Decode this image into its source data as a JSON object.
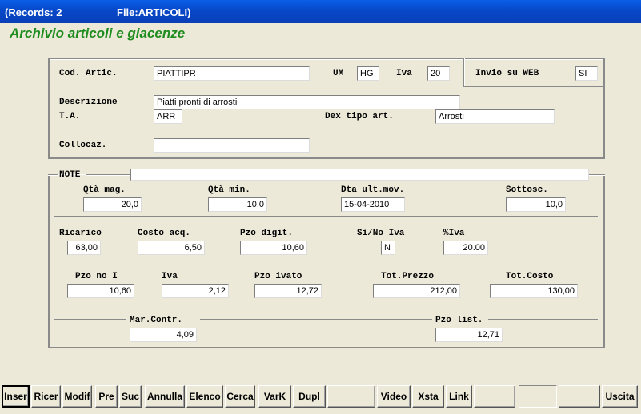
{
  "titlebar": {
    "records": "(Records: 2",
    "file": "File:ARTICOLI)"
  },
  "heading": "Archivio articoli e giacenze",
  "top_section": {
    "cod_artic": {
      "label": "Cod. Artic.",
      "value": "PIATTIPR"
    },
    "um": {
      "label": "UM",
      "value": "HG"
    },
    "iva": {
      "label": "Iva",
      "value": "20"
    },
    "invio_web": {
      "label": "Invio su WEB",
      "value": "SI"
    },
    "descrizione": {
      "label": "Descrizione",
      "value": "Piatti pronti di arrosti"
    },
    "ta": {
      "label": "T.A.",
      "value": "ARR"
    },
    "dex_tipo": {
      "label": "Dex tipo art.",
      "value": "Arrosti"
    },
    "collocaz": {
      "label": "Collocaz.",
      "value": ""
    }
  },
  "bottom_section": {
    "note": {
      "label": "NOTE",
      "value": ""
    },
    "qta_mag": {
      "label": "Qtà mag.",
      "value": "20,0"
    },
    "qta_min": {
      "label": "Qtà min.",
      "value": "10,0"
    },
    "dta_ult_mov": {
      "label": "Dta ult.mov.",
      "value": "15-04-2010"
    },
    "sottosc": {
      "label": "Sottosc.",
      "value": "10,0"
    },
    "ricarico": {
      "label": "Ricarico",
      "value": "63,00"
    },
    "costo_acq": {
      "label": "Costo acq.",
      "value": "6,50"
    },
    "pzo_digit": {
      "label": "Pzo digit.",
      "value": "10,60"
    },
    "si_no_iva": {
      "label": "Sì/No Iva",
      "value": "N"
    },
    "perc_iva": {
      "label": "%Iva",
      "value": "20.00"
    },
    "pzo_no_i": {
      "label": "Pzo no I",
      "value": "10,60"
    },
    "iva": {
      "label": "Iva",
      "value": "2,12"
    },
    "pzo_ivato": {
      "label": "Pzo ivato",
      "value": "12,72"
    },
    "tot_prezzo": {
      "label": "Tot.Prezzo",
      "value": "212,00"
    },
    "tot_costo": {
      "label": "Tot.Costo",
      "value": "130,00"
    },
    "mar_contr": {
      "label": "Mar.Contr.",
      "value": "4,09"
    },
    "pzo_list": {
      "label": "Pzo list.",
      "value": "12,71"
    }
  },
  "toolbar": {
    "inser": "Inser",
    "ricer": "Ricer",
    "modif": "Modif",
    "pre": "Pre",
    "suc": "Suc",
    "annulla": "Annulla",
    "elenco": "Elenco",
    "cerca": "Cerca",
    "vark": "VarK",
    "dupl": "Dupl",
    "video": "Video",
    "xsta": "Xsta",
    "link": "Link",
    "uscita": "Uscita"
  }
}
